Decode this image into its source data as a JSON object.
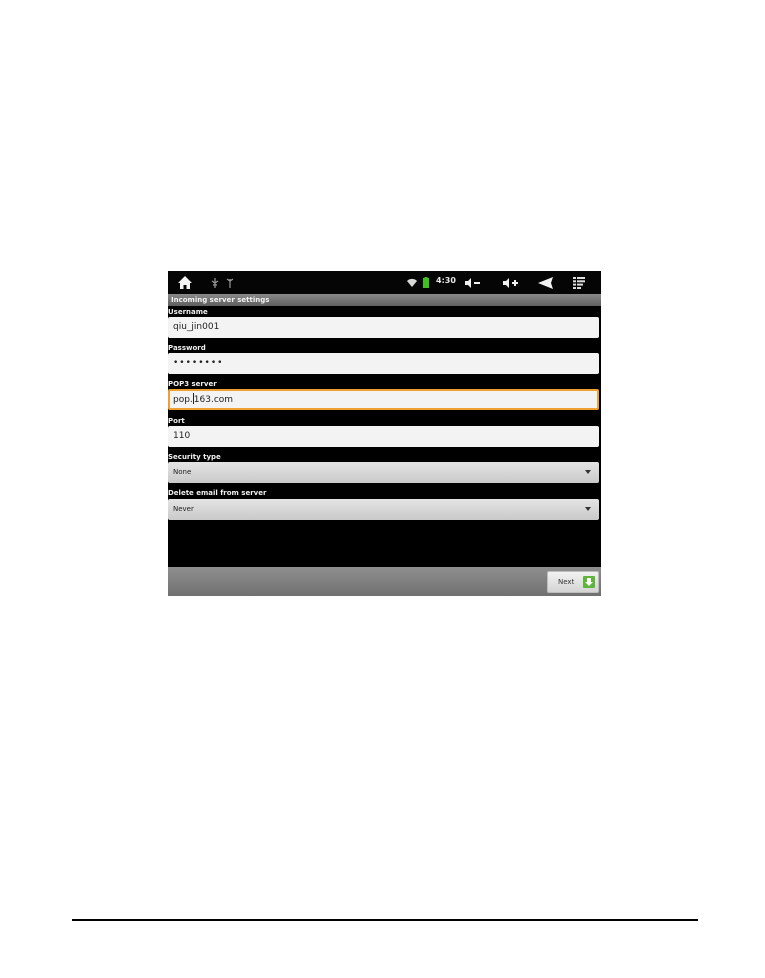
{
  "status_bar": {
    "time": "4:30",
    "icons": [
      "home-icon",
      "usb-icon",
      "usb-debug-icon",
      "wifi-icon",
      "battery-icon",
      "volume-down-icon",
      "volume-up-icon",
      "back-icon",
      "menu-icon"
    ],
    "battery_color": "#3ec21e"
  },
  "screen": {
    "title": "Incoming server settings"
  },
  "form": {
    "username": {
      "label": "Username",
      "value": "qiu_jin001"
    },
    "password": {
      "label": "Password",
      "value": "••••••••"
    },
    "pop3_server": {
      "label": "POP3 server",
      "value_before_caret": "pop.",
      "value_after_caret": "163.com"
    },
    "port": {
      "label": "Port",
      "value": "110"
    },
    "security_type": {
      "label": "Security type",
      "value": "None"
    },
    "delete_email": {
      "label": "Delete email from server",
      "value": "Never"
    }
  },
  "actions": {
    "next_label": "Next"
  },
  "colors": {
    "focus_border": "#f0a030",
    "next_icon": "#5fb53c"
  }
}
